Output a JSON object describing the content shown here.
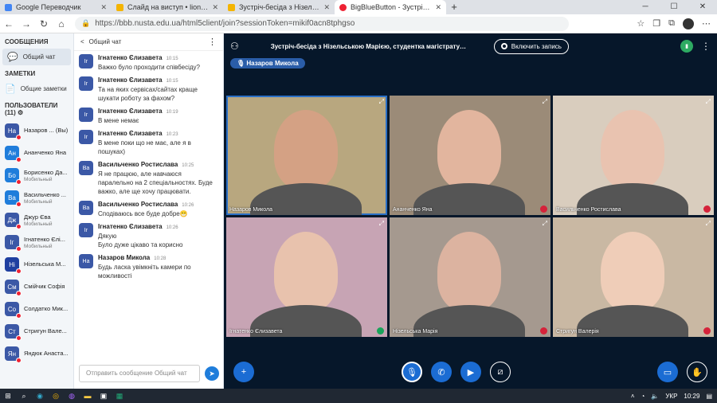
{
  "browser": {
    "tabs": [
      {
        "label": "Google Переводчик",
        "color": "#4285f4"
      },
      {
        "label": "Слайд на виступ • lion1009@uk",
        "color": "#f4b400"
      },
      {
        "label": "Зустріч-бесіда з Нізельською М",
        "color": "#f4b400"
      },
      {
        "label": "BigBlueButton - Зустріч-бесіда",
        "color": "#e23"
      }
    ],
    "new_tab": "+",
    "url": "https://bbb.nusta.edu.ua/html5client/join?sessionToken=mikif0acn8tphgso"
  },
  "sidebar": {
    "messages_header": "СООБЩЕНИЯ",
    "public_chat": "Общий чат",
    "notes_header": "ЗАМЕТКИ",
    "shared_notes": "Общие заметки",
    "users_header": "ПОЛЬЗОВАТЕЛИ (11)",
    "users": [
      {
        "initials": "На",
        "name": "Назаров ...",
        "sub": "(Вы)",
        "color": "#3b58a6"
      },
      {
        "initials": "Ан",
        "name": "Ананченко Яна",
        "sub": "",
        "color": "#1f7ddb"
      },
      {
        "initials": "Бо",
        "name": "Борисенко Да...",
        "sub": "Мобильный",
        "color": "#1f7ddb"
      },
      {
        "initials": "Ва",
        "name": "Васильченко ...",
        "sub": "Мобильный",
        "color": "#1f7ddb"
      },
      {
        "initials": "Дж",
        "name": "Джур Єва",
        "sub": "Мобильный",
        "color": "#3b58a6"
      },
      {
        "initials": "Іг",
        "name": "Ігнатенко Єлі...",
        "sub": "Мобильный",
        "color": "#3b58a6"
      },
      {
        "initials": "Ні",
        "name": "Нізельська М...",
        "sub": "",
        "color": "#1f3fa0"
      },
      {
        "initials": "См",
        "name": "Смійчик Софія",
        "sub": "",
        "color": "#3b58a6"
      },
      {
        "initials": "Со",
        "name": "Солдатко Мик...",
        "sub": "",
        "color": "#3b58a6"
      },
      {
        "initials": "Ст",
        "name": "Стригун Вале...",
        "sub": "",
        "color": "#3b58a6"
      },
      {
        "initials": "Ян",
        "name": "Яндюк Анаста...",
        "sub": "",
        "color": "#3b58a6"
      }
    ]
  },
  "chat": {
    "title": "Общий чат",
    "back": "<",
    "messages": [
      {
        "initials": "Іг",
        "name": "Ігнатенко Єлизавета",
        "time": "10:15",
        "text": "Важко було проходити співбесіду?"
      },
      {
        "initials": "Іг",
        "name": "Ігнатенко Єлизавета",
        "time": "10:15",
        "text": "Та на яких сервісах/сайтах краще шукати роботу за фахом?"
      },
      {
        "initials": "Іг",
        "name": "Ігнатенко Єлизавета",
        "time": "10:19",
        "text": "В мене немає"
      },
      {
        "initials": "Іг",
        "name": "Ігнатенко Єлизавета",
        "time": "10:23",
        "text": "В мене поки що не має, але я в пошуках)"
      },
      {
        "initials": "Ва",
        "name": "Васильченко Ростислава",
        "time": "10:25",
        "text": "Я не працюю, але навчаюся паралельно на 2 спеціальностях. Буде важко, але ще хочу працювати."
      },
      {
        "initials": "Ва",
        "name": "Васильченко Ростислава",
        "time": "10:26",
        "text": "Сподіваюсь все буде добре😁"
      },
      {
        "initials": "Іг",
        "name": "Ігнатенко Єлизавета",
        "time": "10:26",
        "text": "Дякую\nБуло дуже цікаво та корисно"
      },
      {
        "initials": "На",
        "name": "Назаров Микола",
        "time": "10:28",
        "text": "Будь ласка увімкніть камери по можливості"
      }
    ],
    "input_placeholder": "Отправить сообщение Общий чат"
  },
  "meeting": {
    "title": "Зустріч-бесіда з Нізельською Марією, студентка магістратури та м...",
    "record_label": "Включить запись",
    "talking": "Назаров Микола",
    "tiles": [
      {
        "name": "Назаров Микола",
        "mic": "none",
        "bg": "#b8a77f",
        "skin": "#d4a184",
        "speaking": true
      },
      {
        "name": "Ананченко Яна",
        "mic": "off",
        "bg": "#9b8b78",
        "skin": "#e2b59e",
        "speaking": false
      },
      {
        "name": "Васильченко Ростислава",
        "mic": "off",
        "bg": "#d9cdbe",
        "skin": "#e9c3b0",
        "speaking": false
      },
      {
        "name": "Ігнатенко Єлизавета",
        "mic": "on",
        "bg": "#c7a4b4",
        "skin": "#e8c2ad",
        "speaking": false
      },
      {
        "name": "Нізельська Марія",
        "mic": "off",
        "bg": "#a5998f",
        "skin": "#dcb3a0",
        "speaking": false
      },
      {
        "name": "Стригун Валерія",
        "mic": "off",
        "bg": "#c9b8a3",
        "skin": "#efcdb8",
        "speaking": false
      }
    ]
  },
  "taskbar": {
    "lang": "УКР",
    "time": "10:29"
  }
}
